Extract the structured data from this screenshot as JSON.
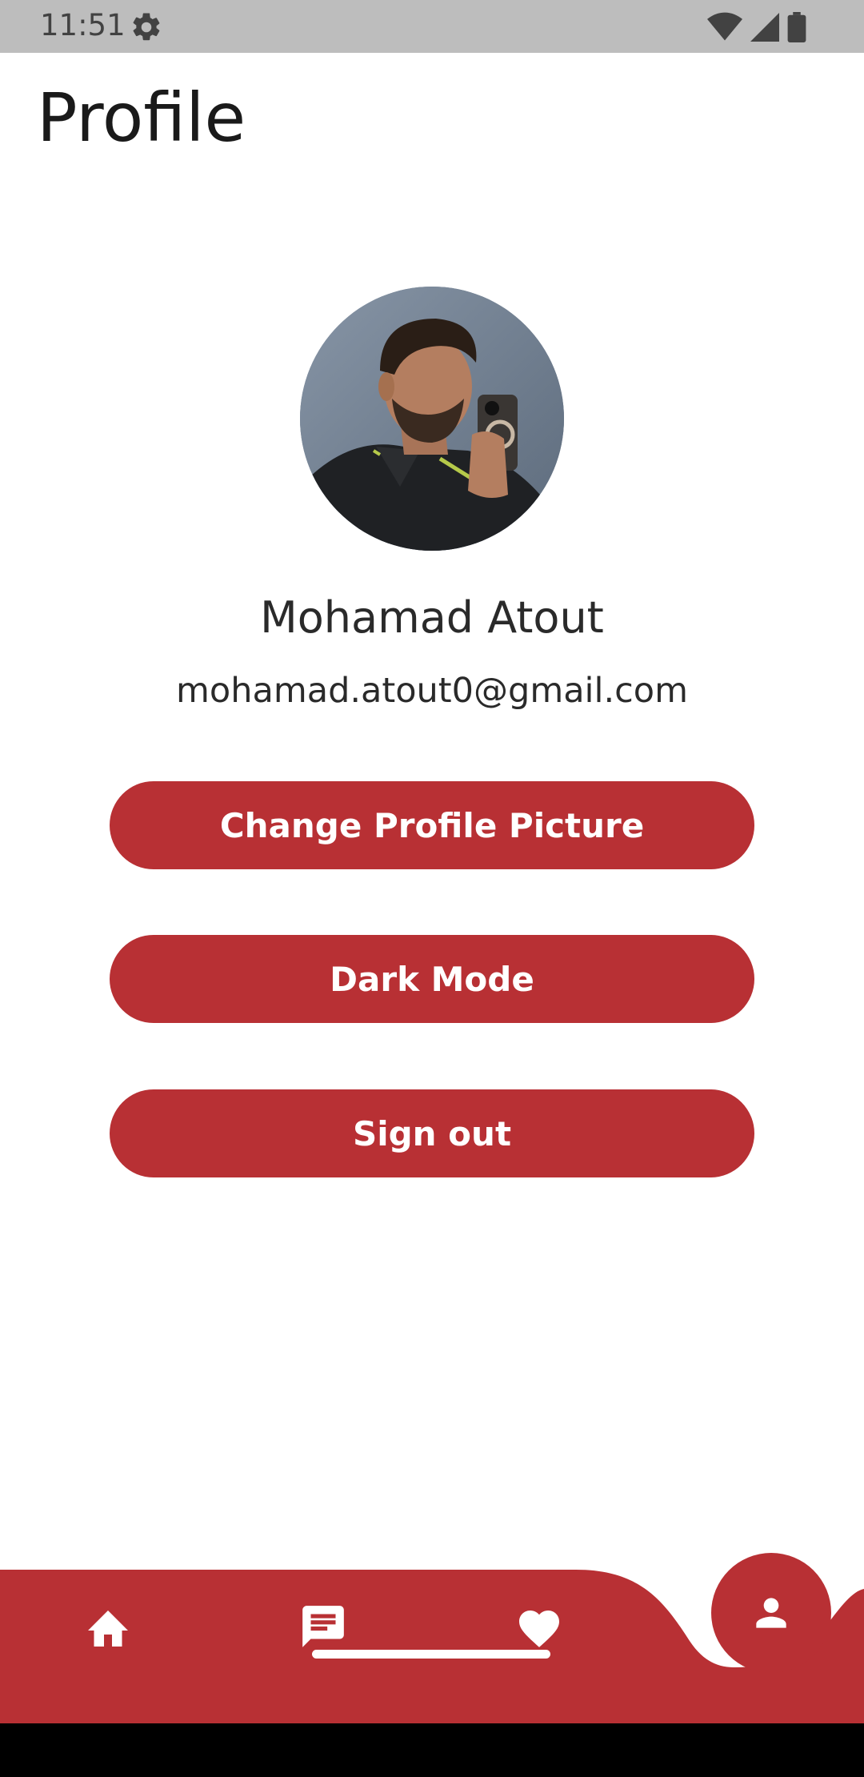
{
  "status_bar": {
    "time": "11:51",
    "icons": [
      "gear-icon",
      "wifi-icon",
      "signal-icon",
      "battery-icon"
    ]
  },
  "page": {
    "title": "Profile"
  },
  "profile": {
    "name": "Mohamad Atout",
    "email": "mohamad.atout0@gmail.com"
  },
  "actions": {
    "change_picture_label": "Change Profile Picture",
    "dark_mode_label": "Dark Mode",
    "sign_out_label": "Sign out"
  },
  "bottom_nav": {
    "items": [
      {
        "icon": "home-icon"
      },
      {
        "icon": "chat-icon"
      },
      {
        "icon": "heart-icon"
      },
      {
        "icon": "person-icon",
        "active": true
      }
    ]
  },
  "colors": {
    "accent": "#b83034",
    "status_bar": "#bdbdbd",
    "background": "#ffffff",
    "text": "#2a2a2a"
  }
}
